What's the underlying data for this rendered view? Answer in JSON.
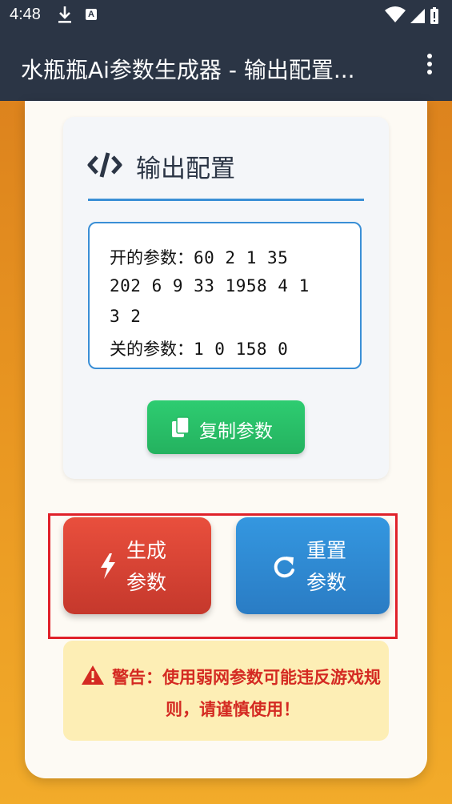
{
  "status_bar": {
    "time": "4:48",
    "icons": [
      "download-icon",
      "a-icon",
      "wifi-icon",
      "signal-icon",
      "battery-icon"
    ]
  },
  "app_bar": {
    "title": "水瓶瓶Ai参数生成器 - 输出配置...",
    "menu_icon": "more-vert-icon"
  },
  "output_card": {
    "icon": "code-icon",
    "title": "输出配置",
    "on_label": "开的参数：",
    "on_line1": "60 2 1 35",
    "on_line2": "202 6 9 33 1958 4 1",
    "on_line3": "3 2",
    "off_label": "关的参数：",
    "off_values": "1 0 158 0",
    "copy_button": "复制参数",
    "copy_icon": "copy-icon"
  },
  "actions": {
    "generate_line1": "生成",
    "generate_line2": "参数",
    "generate_icon": "bolt-icon",
    "reset_line1": "重置",
    "reset_line2": "参数",
    "reset_icon": "redo-icon"
  },
  "warning": {
    "icon": "warning-triangle-icon",
    "text": "警告：使用弱网参数可能违反游戏规则，请谨慎使用！"
  },
  "colors": {
    "header_bg": "#2b3545",
    "accent_blue": "#3a8fd6",
    "copy_green": "#2ecc71",
    "generate_red": "#e94f3d",
    "reset_blue": "#3497e0",
    "warning_bg": "#fdeeb5",
    "warning_text": "#d42a22",
    "highlight_border": "#e0212a"
  }
}
